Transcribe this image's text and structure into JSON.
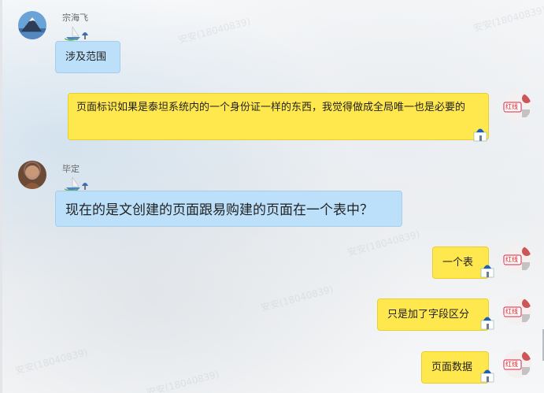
{
  "watermark": "安安(18040839)",
  "messages": [
    {
      "sender": "宗海飞",
      "side": "left",
      "text": "涉及范围"
    },
    {
      "sender": "",
      "side": "right",
      "avatar_label": "红线",
      "text": "页面标识如果是泰坦系统内的一个身份证一样的东西，我觉得做成全局唯一也是必要的"
    },
    {
      "sender": "毕定",
      "side": "left",
      "text": "现在的是文创建的页面跟易购建的页面在一个表中？"
    },
    {
      "sender": "",
      "side": "right",
      "avatar_label": "红线",
      "text": "一个表"
    },
    {
      "sender": "",
      "side": "right",
      "avatar_label": "红线",
      "text": "只是加了字段区分"
    },
    {
      "sender": "",
      "side": "right",
      "avatar_label": "红线",
      "text": "页面数据"
    }
  ],
  "colors": {
    "incoming_bubble": "#bde0fa",
    "outgoing_bubble": "#ffe84d"
  }
}
